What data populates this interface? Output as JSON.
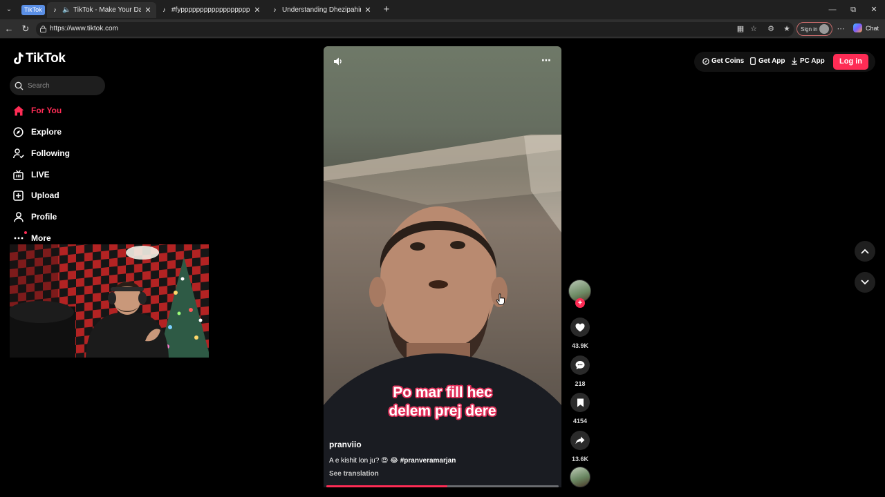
{
  "browser": {
    "tab_group_label": "TikTok",
    "tabs": [
      {
        "title": "TikTok - Make Your Day",
        "favicon": "tiktok-icon",
        "playing_audio": true
      },
      {
        "title": "#fypppppppppppppppppppppp",
        "favicon": "tiktok-icon"
      },
      {
        "title": "Understanding Dhezipahiri Lyrics: A",
        "favicon": "tiktok-icon"
      }
    ],
    "url": "https://www.tiktok.com",
    "signin_label": "Sign in",
    "chat_label": "Chat"
  },
  "sidebar": {
    "logo_text": "TikTok",
    "search_placeholder": "Search",
    "nav": [
      {
        "label": "For You",
        "icon": "home-icon",
        "active": true
      },
      {
        "label": "Explore",
        "icon": "compass-icon"
      },
      {
        "label": "Following",
        "icon": "following-icon"
      },
      {
        "label": "LIVE",
        "icon": "live-icon"
      },
      {
        "label": "Upload",
        "icon": "upload-icon"
      },
      {
        "label": "Profile",
        "icon": "profile-icon"
      },
      {
        "label": "More",
        "icon": "more-icon"
      }
    ]
  },
  "video": {
    "caption_line1": "Po mar fill hec",
    "caption_line2": "delem prej dere",
    "author": "pranviio",
    "description": "A e kishit lon ju? 😍 😂 ",
    "hashtag": "#pranveramarjan",
    "see_translation": "See translation",
    "progress": 0.52
  },
  "actions": {
    "likes": "43.9K",
    "comments": "218",
    "saves": "4154",
    "shares": "13.6K"
  },
  "header": {
    "get_coins": "Get Coins",
    "get_app": "Get App",
    "pc_app": "PC App",
    "login": "Log in"
  },
  "colors": {
    "accent": "#fe2c55",
    "background": "#000000"
  }
}
